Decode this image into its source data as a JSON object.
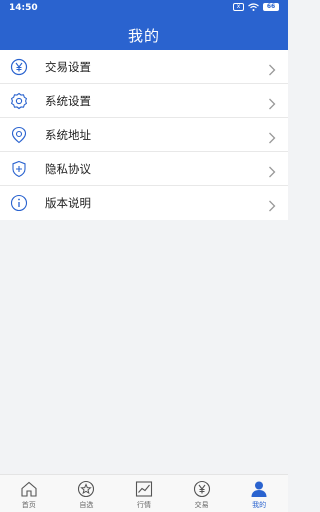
{
  "status": {
    "time": "14:50",
    "sim": "x",
    "battery": "66"
  },
  "header": {
    "title": "我的"
  },
  "menu": {
    "items": [
      {
        "label": "交易设置",
        "icon": "yen-circle-icon"
      },
      {
        "label": "系统设置",
        "icon": "gear-icon"
      },
      {
        "label": "系统地址",
        "icon": "location-icon"
      },
      {
        "label": "隐私协议",
        "icon": "shield-plus-icon"
      },
      {
        "label": "版本说明",
        "icon": "info-icon"
      }
    ]
  },
  "tabbar": {
    "items": [
      {
        "label": "首页",
        "icon": "home-icon"
      },
      {
        "label": "自选",
        "icon": "star-circle-icon"
      },
      {
        "label": "行情",
        "icon": "chart-icon"
      },
      {
        "label": "交易",
        "icon": "yen-circle-icon"
      },
      {
        "label": "我的",
        "icon": "user-icon",
        "active": true
      }
    ]
  },
  "colors": {
    "accent": "#2a63cf",
    "background": "#f2f3f5"
  }
}
